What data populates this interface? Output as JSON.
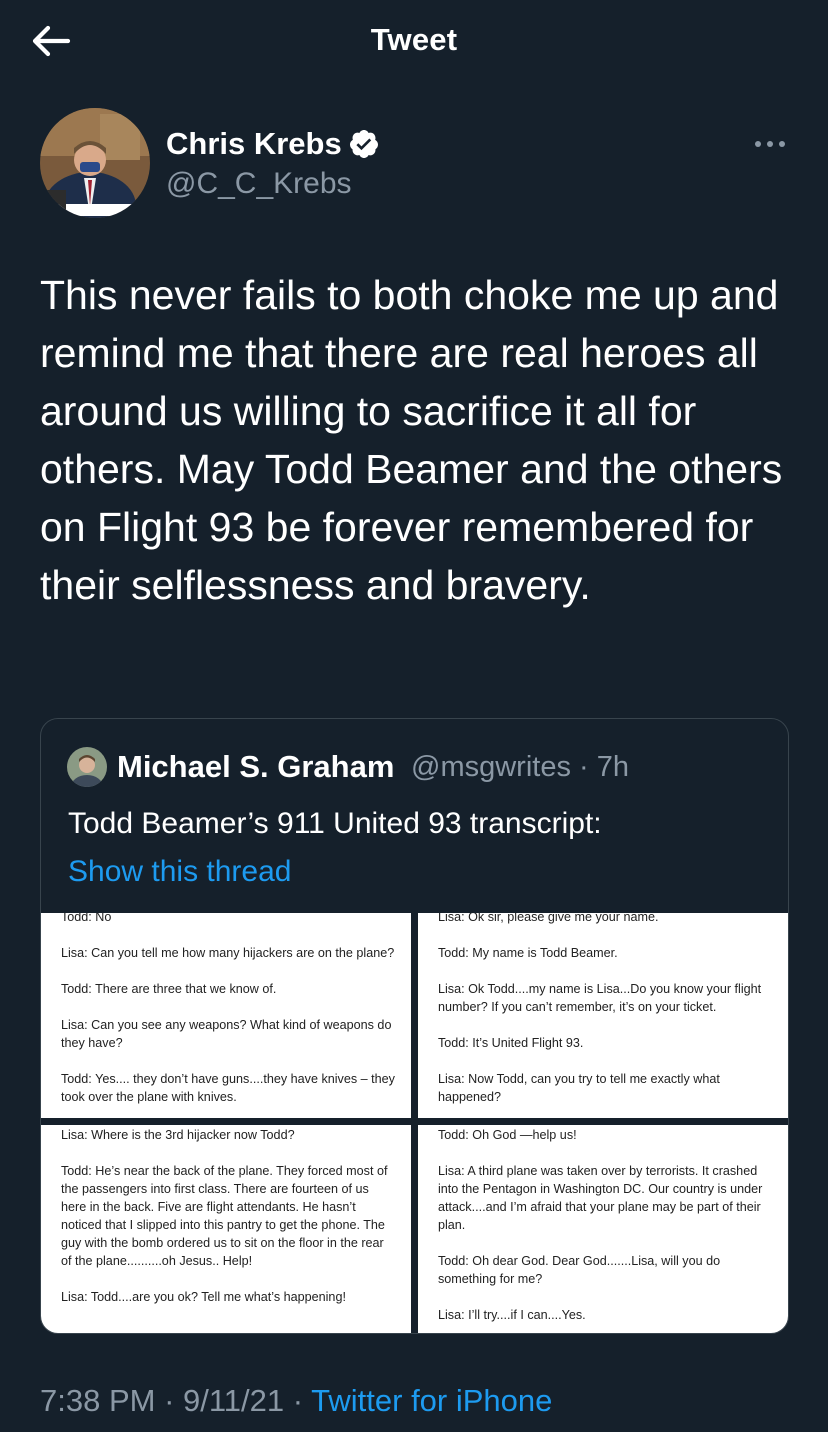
{
  "header": {
    "title": "Tweet"
  },
  "tweet": {
    "author_name": "Chris Krebs",
    "author_handle": "@C_C_Krebs",
    "text": "This never fails to both choke me up and remind me that there are real heroes all around us willing to sacrifice it all for others. May Todd Beamer and the others on Flight 93 be forever remembered for their selflessness and bravery.",
    "time": "7:38 PM",
    "date": "9/11/21",
    "source": "Twitter for iPhone"
  },
  "quoted": {
    "author_name": "Michael S. Graham",
    "author_handle": "@msgwrites",
    "age": "7h",
    "text": "Todd Beamer’s 911 United 93 transcript:",
    "show_thread": "Show this thread"
  },
  "transcript": {
    "top_left": [
      "Todd: No",
      "Lisa: Can you tell me how many hijackers are on the plane?",
      "Todd: There are three that we know of.",
      "Lisa: Can you see any weapons? What kind of weapons do they have?",
      "Todd: Yes.... they don’t have guns....they have knives – they took over the plane with knives."
    ],
    "top_right": [
      "Lisa: Ok sir, please give me your name.",
      "Todd: My name is Todd Beamer.",
      "Lisa: Ok Todd....my name is Lisa...Do you know your flight number? If you can’t remember, it’s on your ticket.",
      "Todd: It’s United Flight 93.",
      "Lisa: Now Todd, can you try to tell me exactly what happened?"
    ],
    "bottom_left": [
      "Lisa: Where is the 3rd hijacker now Todd?",
      "Todd: He’s near the back of the plane. They forced most of the passengers into first class. There are fourteen of us here in the back. Five are flight attendants. He hasn’t noticed that I slipped into this pantry to get the phone. The guy with the bomb ordered us to sit on the floor in the rear of the plane..........oh Jesus.. Help!",
      "Lisa: Todd....are you ok? Tell me what’s happening!"
    ],
    "bottom_right": [
      "Todd: Oh God —help us!",
      "Lisa: A third plane was taken over by terrorists. It crashed into the Pentagon in Washington DC. Our country is under attack....and I’m afraid that your plane may be part of their plan.",
      "Todd: Oh dear God. Dear God.......Lisa, will you do something for me?",
      "Lisa: I’ll try....if I can....Yes."
    ]
  },
  "icons": [
    "back-arrow-icon",
    "verified-badge-icon",
    "more-options-icon"
  ],
  "colors": {
    "background": "#15202b",
    "link": "#1d9bf0",
    "secondary_text": "#8b98a5",
    "border": "#38444d"
  }
}
